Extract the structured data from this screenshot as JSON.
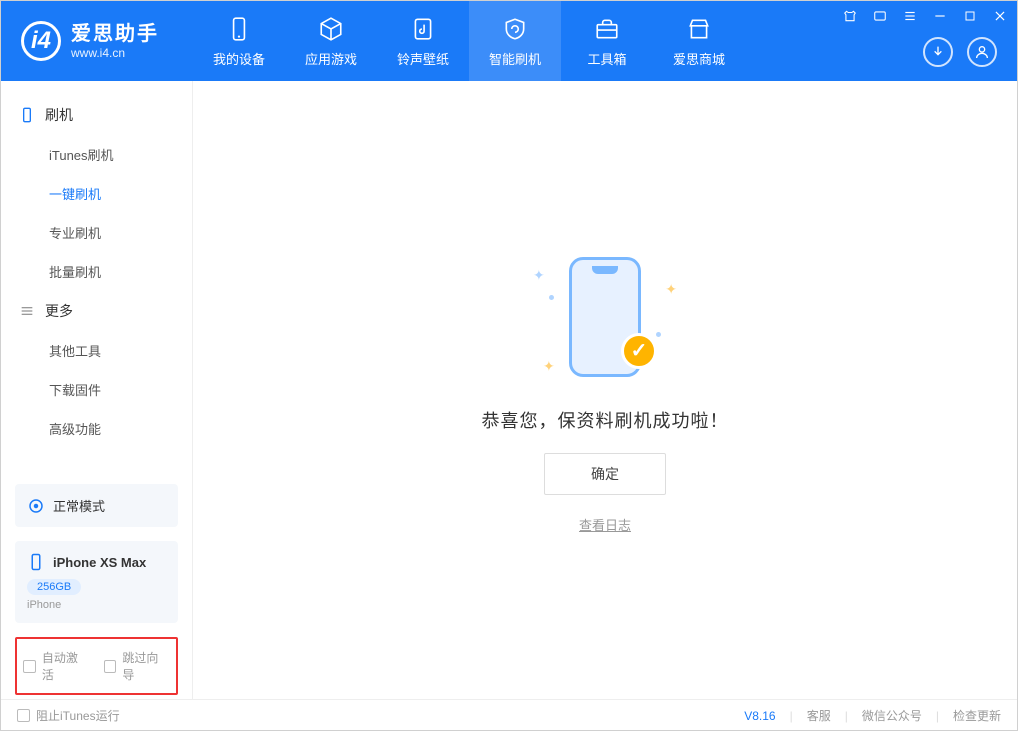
{
  "app": {
    "logo_title": "爱思助手",
    "logo_sub": "www.i4.cn"
  },
  "nav": {
    "tabs": [
      {
        "label": "我的设备"
      },
      {
        "label": "应用游戏"
      },
      {
        "label": "铃声壁纸"
      },
      {
        "label": "智能刷机"
      },
      {
        "label": "工具箱"
      },
      {
        "label": "爱思商城"
      }
    ],
    "active_index": 3
  },
  "sidebar": {
    "groups": [
      {
        "title": "刷机",
        "items": [
          "iTunes刷机",
          "一键刷机",
          "专业刷机",
          "批量刷机"
        ],
        "active_index": 1
      },
      {
        "title": "更多",
        "items": [
          "其他工具",
          "下载固件",
          "高级功能"
        ],
        "active_index": -1
      }
    ],
    "mode_card": "正常模式",
    "device": {
      "name": "iPhone XS Max",
      "storage": "256GB",
      "type": "iPhone"
    },
    "checkboxes": {
      "auto_activate": "自动激活",
      "skip_guide": "跳过向导"
    }
  },
  "main": {
    "success_text": "恭喜您，保资料刷机成功啦！",
    "ok_button": "确定",
    "view_log": "查看日志"
  },
  "footer": {
    "block_itunes": "阻止iTunes运行",
    "version": "V8.16",
    "links": [
      "客服",
      "微信公众号",
      "检查更新"
    ]
  }
}
